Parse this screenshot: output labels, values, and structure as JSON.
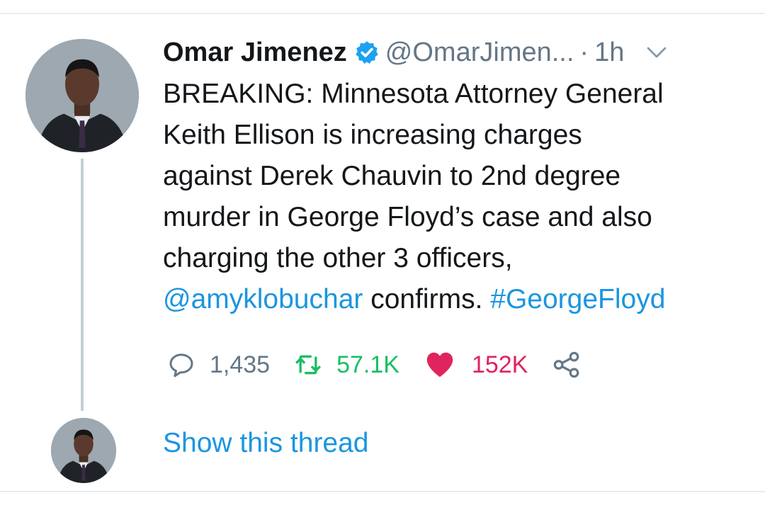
{
  "tweet": {
    "author_name": "Omar Jimenez",
    "handle": "@OmarJimen...",
    "separator": "·",
    "time": "1h",
    "lines": [
      "BREAKING: Minnesota Attorney General",
      "Keith Ellison is increasing charges",
      "against Derek Chauvin to 2nd degree",
      "murder in George Floyd’s case and also",
      "charging the other 3 officers,"
    ],
    "mention": "@amyklobuchar",
    "after_mention": " confirms. ",
    "hashtag": "#GeorgeFloyd"
  },
  "actions": {
    "reply_count": "1,435",
    "retweet_count": "57.1K",
    "like_count": "152K"
  },
  "thread": {
    "show_label": "Show this thread"
  },
  "icons": {
    "verified": "verified-badge-icon",
    "caret": "chevron-down-icon",
    "reply": "reply-icon",
    "retweet": "retweet-icon",
    "like": "heart-icon",
    "share": "share-icon"
  },
  "colors": {
    "link": "#1b95e0",
    "secondary_text": "#657786",
    "retweet": "#17bf63",
    "like": "#e0245e",
    "thread_line": "#c4cfd6"
  }
}
